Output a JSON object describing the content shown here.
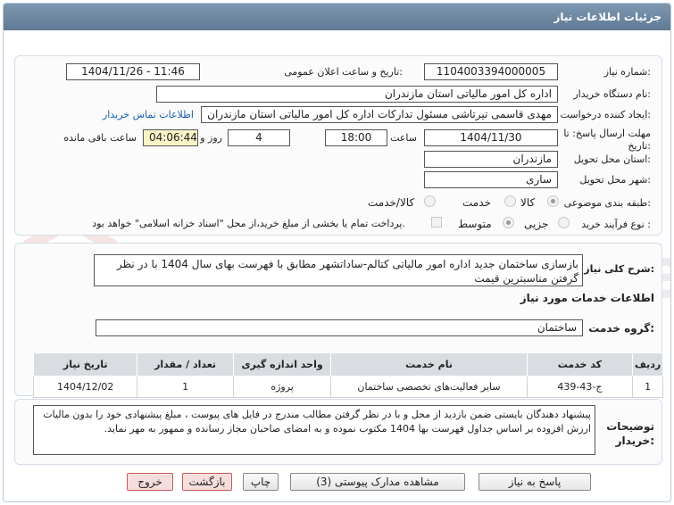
{
  "window": {
    "title": "جزئیات اطلاعات نیاز"
  },
  "watermark": {
    "text": "AriaTender.net"
  },
  "fields": {
    "need_number_label": "شماره نیاز:",
    "need_number": "1104003394000005",
    "announce_label": "تاریخ و ساعت اعلان عمومی:",
    "announce_value": "1404/11/26 - 11:46",
    "buyer_label": "نام دستگاه خریدار:",
    "buyer_value": "اداره کل امور مالیاتی استان مازندران",
    "creator_label": "ایجاد کننده درخواست:",
    "creator_value": "مهدی قاسمی تیرتاشی مسئول تدارکات اداره کل امور مالیاتی استان مازندران",
    "contact_link": "اطلاعات تماس خریدار",
    "deadline_label": "مهلت ارسال پاسخ: تا تاریخ:",
    "deadline_date": "1404/11/30",
    "time_label": "ساعت",
    "deadline_time": "18:00",
    "days_value": "4",
    "days_label": "روز و",
    "remaining_time": "04:06:44",
    "remaining_label": "ساعت باقی مانده",
    "province_label": "استان محل تحویل:",
    "province_value": "مازندران",
    "city_label": "شهر محل تحویل:",
    "city_value": "ساری",
    "category_label": "طبقه بندی موضوعی:",
    "category_options": [
      "کالا",
      "خدمت",
      "کالا/خدمت"
    ],
    "category_selected": "کالا",
    "process_label": "نوع فرآیند خرید :",
    "process_options": [
      "جزیی",
      "متوسط"
    ],
    "process_selected": "متوسط",
    "payment_note": "پرداخت تمام یا بخشی از مبلغ خرید،از محل \"اسناد خزانه اسلامی\" خواهد بود."
  },
  "summary": {
    "label": "شرح کلی نیاز:",
    "text": "بازسازی ساختمان جدید اداره امور مالیاتی کتالم-ساداتشهر مطابق با فهرست بهای سال 1404  با در نظر گرفتن مناسبترین قیمت"
  },
  "services": {
    "heading": "اطلاعات خدمات مورد نیاز",
    "group_label": "گروه خدمت:",
    "group_value": "ساختمان",
    "columns": [
      "ردیف",
      "کد خدمت",
      "نام خدمت",
      "واحد اندازه گیری",
      "تعداد / مقدار",
      "تاریخ نیاز"
    ],
    "rows": [
      [
        "1",
        "ج-43-439",
        "سایر فعالیت‌های تخصصی ساختمان",
        "پروژه",
        "1",
        "1404/12/02"
      ]
    ]
  },
  "buyer_notes": {
    "label": "توضیحات خریدار:",
    "text": "پیشنهاد دهندگان بایستی ضمن بازدید از محل و با در نظر گرفتن مطالب مندرج در فایل های پیوست ، مبلغ پیشنهادی خود را بدون مالیات ارزش افزوده بر اساس جداول فهرست بها 1404 مکتوب نموده  و به امضای صاحبان مجاز رسانده و ممهور به مهر نماید."
  },
  "buttons": {
    "reply": "پاسخ به نیاز",
    "attachments": "مشاهده مدارک پیوستی (3)",
    "print": "چاپ",
    "back": "بازگشت",
    "exit": "خروج"
  }
}
